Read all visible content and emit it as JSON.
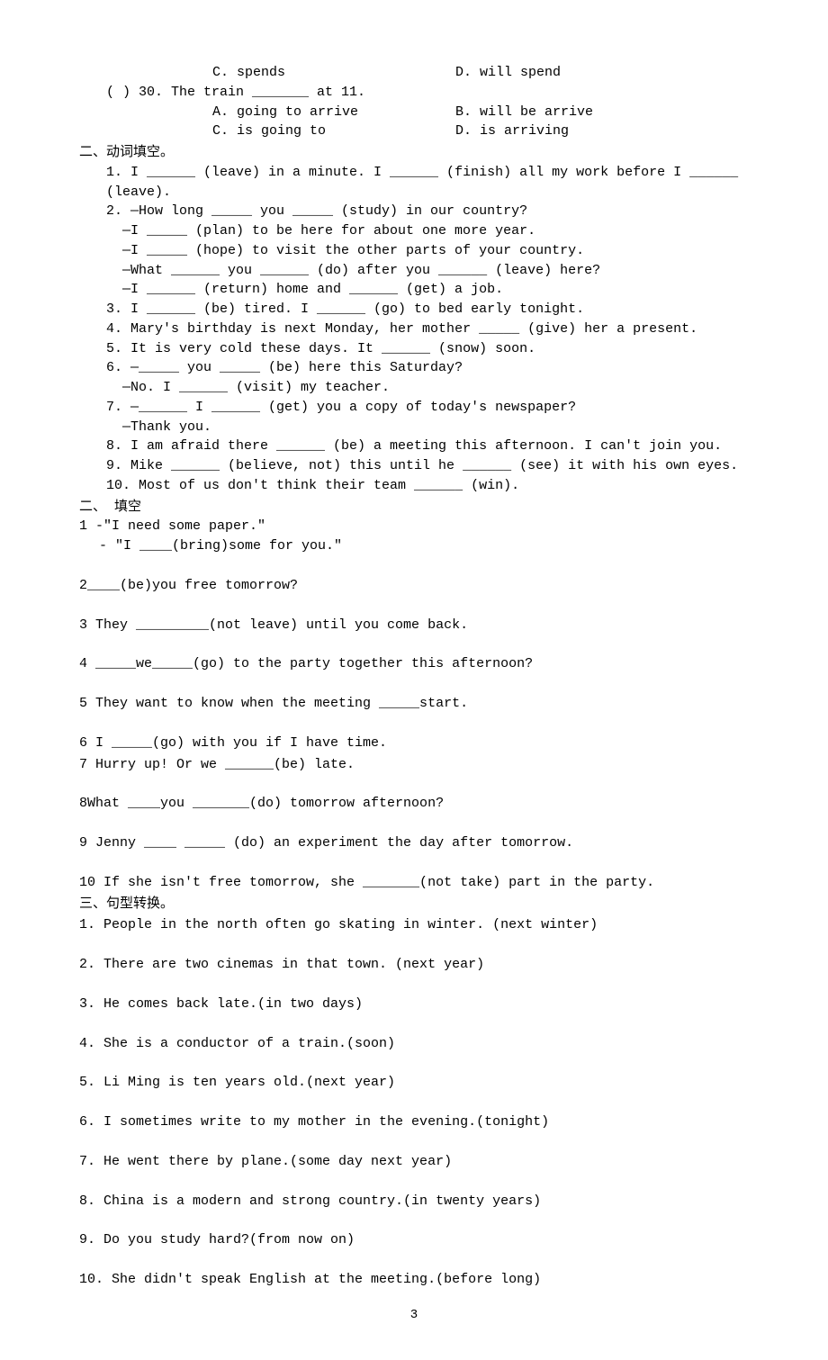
{
  "top": {
    "optC": "C. spends",
    "optD": "D. will spend",
    "q30": "(   ) 30. The train _______ at 11.",
    "q30A": "A. going to arrive",
    "q30B": "B. will be arrive",
    "q30C": "C. is going to",
    "q30D": "D. is arriving"
  },
  "sec1": {
    "heading": "二、动词填空。",
    "i1": "1. I ______ (leave) in a minute. I ______ (finish) all my work before I ______ (leave).",
    "i2a": "2. —How long _____ you _____ (study) in our country?",
    "i2b": "—I _____ (plan) to be here for about one more year.",
    "i2c": "—I _____ (hope) to visit the other parts of your country.",
    "i2d": "—What ______ you ______ (do) after you ______ (leave) here?",
    "i2e": "—I ______ (return) home and ______ (get) a job.",
    "i3": "3. I ______ (be) tired. I ______ (go) to bed early tonight.",
    "i4": "4. Mary's birthday is next Monday, her mother _____ (give) her a present.",
    "i5": "5. It is very cold these days. It ______ (snow) soon.",
    "i6a": "6. —_____ you _____ (be) here this Saturday?",
    "i6b": "—No. I ______ (visit) my teacher.",
    "i7a": "7. —______ I ______ (get) you a copy of today's newspaper?",
    "i7b": "—Thank you.",
    "i8": "8. I am afraid there ______ (be) a meeting this afternoon. I can't join you.",
    "i9": "9. Mike ______ (believe, not) this until he ______ (see) it with his own eyes.",
    "i10": "10. Most of us don't think their team ______ (win)."
  },
  "sec2": {
    "heading": "二、 填空",
    "i1a": "1 -\"I need some paper.\"",
    "i1b": "- \"I ____(bring)some for you.\"",
    "i2": "2____(be)you free tomorrow?",
    "i3": "3 They _________(not leave) until you come back.",
    "i4": "4 _____we_____(go) to the party together this afternoon?",
    "i5": "5 They want to know when the meeting _____start.",
    "i6": "6 I _____(go) with you if I have time.",
    "i7": "7 Hurry up! Or we ______(be) late.",
    "i8": "8What ____you _______(do) tomorrow afternoon?",
    "i9": "9 Jenny ____ _____ (do) an experiment the day after tomorrow.",
    "i10": "10 If she isn't free tomorrow, she _______(not take) part in the party."
  },
  "sec3": {
    "heading": "三、句型转换。",
    "i1": "1. People in the north often go skating in winter. (next winter)",
    "i2": "2. There are two cinemas in that town. (next year)",
    "i3": "3. He comes back late.(in two days)",
    "i4": "4. She is a conductor of a train.(soon)",
    "i5": "5. Li Ming is ten years old.(next year)",
    "i6": "6. I sometimes write to my mother in the evening.(tonight)",
    "i7": "7. He went there by plane.(some day next year)",
    "i8": "8. China is a modern and strong country.(in twenty years)",
    "i9": "9. Do you study hard?(from now on)",
    "i10": "10. She didn't speak English at the meeting.(before long)"
  },
  "pageNumber": "3"
}
